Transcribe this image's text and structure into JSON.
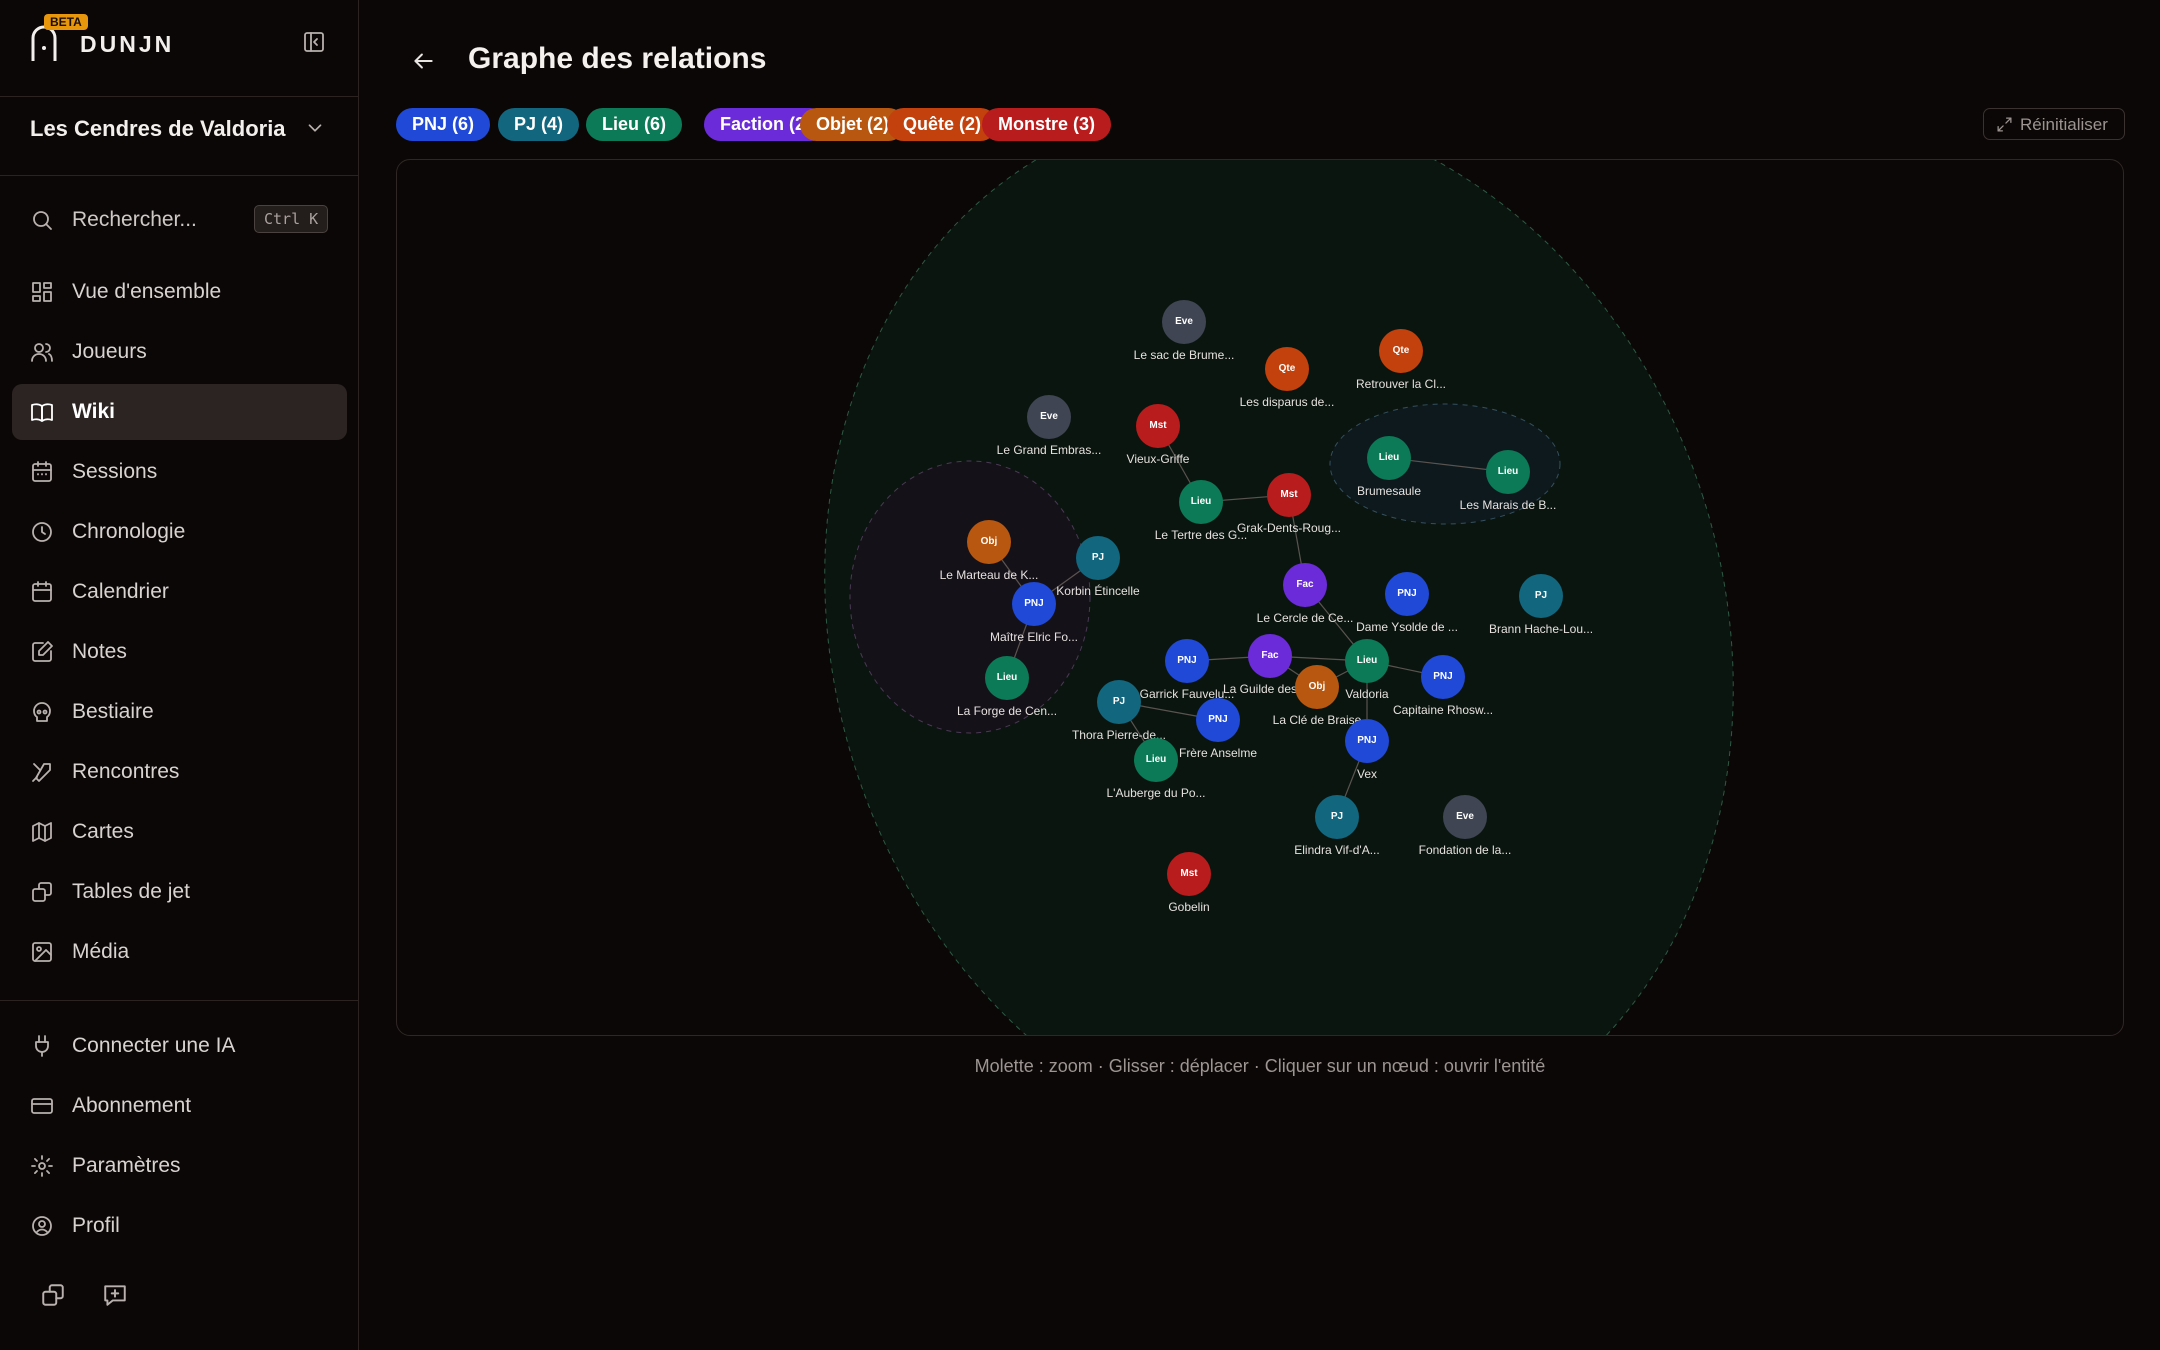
{
  "app": {
    "brand": "DUNJN",
    "beta": "BETA"
  },
  "campaign": {
    "name": "Les Cendres de Valdoria"
  },
  "search": {
    "label": "Rechercher...",
    "shortcut": "Ctrl K"
  },
  "nav": [
    {
      "label": "Vue d'ensemble",
      "icon": "grid-icon"
    },
    {
      "label": "Joueurs",
      "icon": "users-icon"
    },
    {
      "label": "Wiki",
      "icon": "book-icon"
    },
    {
      "label": "Sessions",
      "icon": "calendar-grid-icon"
    },
    {
      "label": "Chronologie",
      "icon": "clock-icon"
    },
    {
      "label": "Calendrier",
      "icon": "calendar-icon"
    },
    {
      "label": "Notes",
      "icon": "notes-icon"
    },
    {
      "label": "Bestiaire",
      "icon": "skull-icon"
    },
    {
      "label": "Rencontres",
      "icon": "swords-icon"
    },
    {
      "label": "Cartes",
      "icon": "map-icon"
    },
    {
      "label": "Tables de jet",
      "icon": "dice-icon"
    },
    {
      "label": "Média",
      "icon": "image-icon"
    }
  ],
  "nav_active": "Wiki",
  "nav2": [
    {
      "label": "Connecter une IA",
      "icon": "plug-icon"
    },
    {
      "label": "Abonnement",
      "icon": "card-icon"
    },
    {
      "label": "Paramètres",
      "icon": "gear-icon"
    },
    {
      "label": "Profil",
      "icon": "profile-icon"
    }
  ],
  "page": {
    "title": "Graphe des relations",
    "reset_label": "Réinitialiser",
    "hint": "Molette : zoom · Glisser : déplacer · Cliquer sur un nœud : ouvrir l'entité"
  },
  "filters": [
    {
      "label": "PNJ (6)",
      "color": "#1f49d6"
    },
    {
      "label": "PJ (4)",
      "color": "#12667e"
    },
    {
      "label": "Lieu (6)",
      "color": "#0c7a56"
    },
    {
      "label": "Faction (2)",
      "color": "#6b2bd9"
    },
    {
      "label": "Objet (2)",
      "color": "#b85710"
    },
    {
      "label": "Quête (2)",
      "color": "#c2410c"
    },
    {
      "label": "Monstre (3)",
      "color": "#b91c1c"
    }
  ],
  "type_colors": {
    "PNJ": "#1f49d6",
    "PJ": "#12667e",
    "Lieu": "#0c7a56",
    "Fac": "#6b2bd9",
    "Obj": "#b85710",
    "Qte": "#c2410c",
    "Mst": "#b91c1c",
    "Eve": "#3f4552"
  },
  "graph": {
    "nodes": [
      {
        "id": "n1",
        "type": "Eve",
        "label": "Le sac de Brume..."
      },
      {
        "id": "n2",
        "type": "Qte",
        "label": "Les disparus de..."
      },
      {
        "id": "n3",
        "type": "Qte",
        "label": "Retrouver la Cl..."
      },
      {
        "id": "n4",
        "type": "Eve",
        "label": "Le Grand Embras..."
      },
      {
        "id": "n5",
        "type": "Mst",
        "label": "Vieux-Griffe"
      },
      {
        "id": "n6",
        "type": "Lieu",
        "label": "Brumesaule"
      },
      {
        "id": "n7",
        "type": "Lieu",
        "label": "Les Marais de B..."
      },
      {
        "id": "n8",
        "type": "Lieu",
        "label": "Le Tertre des G..."
      },
      {
        "id": "n9",
        "type": "Mst",
        "label": "Grak-Dents-Roug..."
      },
      {
        "id": "n10",
        "type": "Obj",
        "label": "Le Marteau de K..."
      },
      {
        "id": "n11",
        "type": "PJ",
        "label": "Korbin Étincelle"
      },
      {
        "id": "n12",
        "type": "Fac",
        "label": "Le Cercle de Ce..."
      },
      {
        "id": "n13",
        "type": "PNJ",
        "label": "Dame Ysolde de ..."
      },
      {
        "id": "n14",
        "type": "PJ",
        "label": "Brann Hache-Lou..."
      },
      {
        "id": "n15",
        "type": "PNJ",
        "label": "Maître Elric Fo..."
      },
      {
        "id": "n16",
        "type": "Lieu",
        "label": "La Forge de Cen..."
      },
      {
        "id": "n17",
        "type": "PNJ",
        "label": "Garrick Fauvelu..."
      },
      {
        "id": "n18",
        "type": "Fac",
        "label": "La Guilde des L..."
      },
      {
        "id": "n19",
        "type": "Lieu",
        "label": "Valdoria"
      },
      {
        "id": "n20",
        "type": "PNJ",
        "label": "Capitaine Rhosw..."
      },
      {
        "id": "n21",
        "type": "Obj",
        "label": "La Clé de Braise"
      },
      {
        "id": "n22",
        "type": "PJ",
        "label": "Thora Pierre-de..."
      },
      {
        "id": "n23",
        "type": "PNJ",
        "label": "Frère Anselme"
      },
      {
        "id": "n24",
        "type": "Lieu",
        "label": "L'Auberge du Po..."
      },
      {
        "id": "n25",
        "type": "PNJ",
        "label": "Vex"
      },
      {
        "id": "n26",
        "type": "PJ",
        "label": "Elindra Vif-d'A..."
      },
      {
        "id": "n27",
        "type": "Eve",
        "label": "Fondation de la..."
      },
      {
        "id": "n28",
        "type": "Mst",
        "label": "Gobelin"
      }
    ],
    "edges": [
      [
        "n5",
        "n8"
      ],
      [
        "n9",
        "n8"
      ],
      [
        "n6",
        "n7"
      ],
      [
        "n9",
        "n12"
      ],
      [
        "n12",
        "n19"
      ],
      [
        "n18",
        "n19"
      ],
      [
        "n17",
        "n18"
      ],
      [
        "n20",
        "n19"
      ],
      [
        "n21",
        "n19"
      ],
      [
        "n22",
        "n23"
      ],
      [
        "n22",
        "n24"
      ],
      [
        "n15",
        "n16"
      ],
      [
        "n10",
        "n15"
      ],
      [
        "n11",
        "n15"
      ],
      [
        "n25",
        "n26"
      ],
      [
        "n18",
        "n21"
      ],
      [
        "n25",
        "n19"
      ]
    ]
  }
}
